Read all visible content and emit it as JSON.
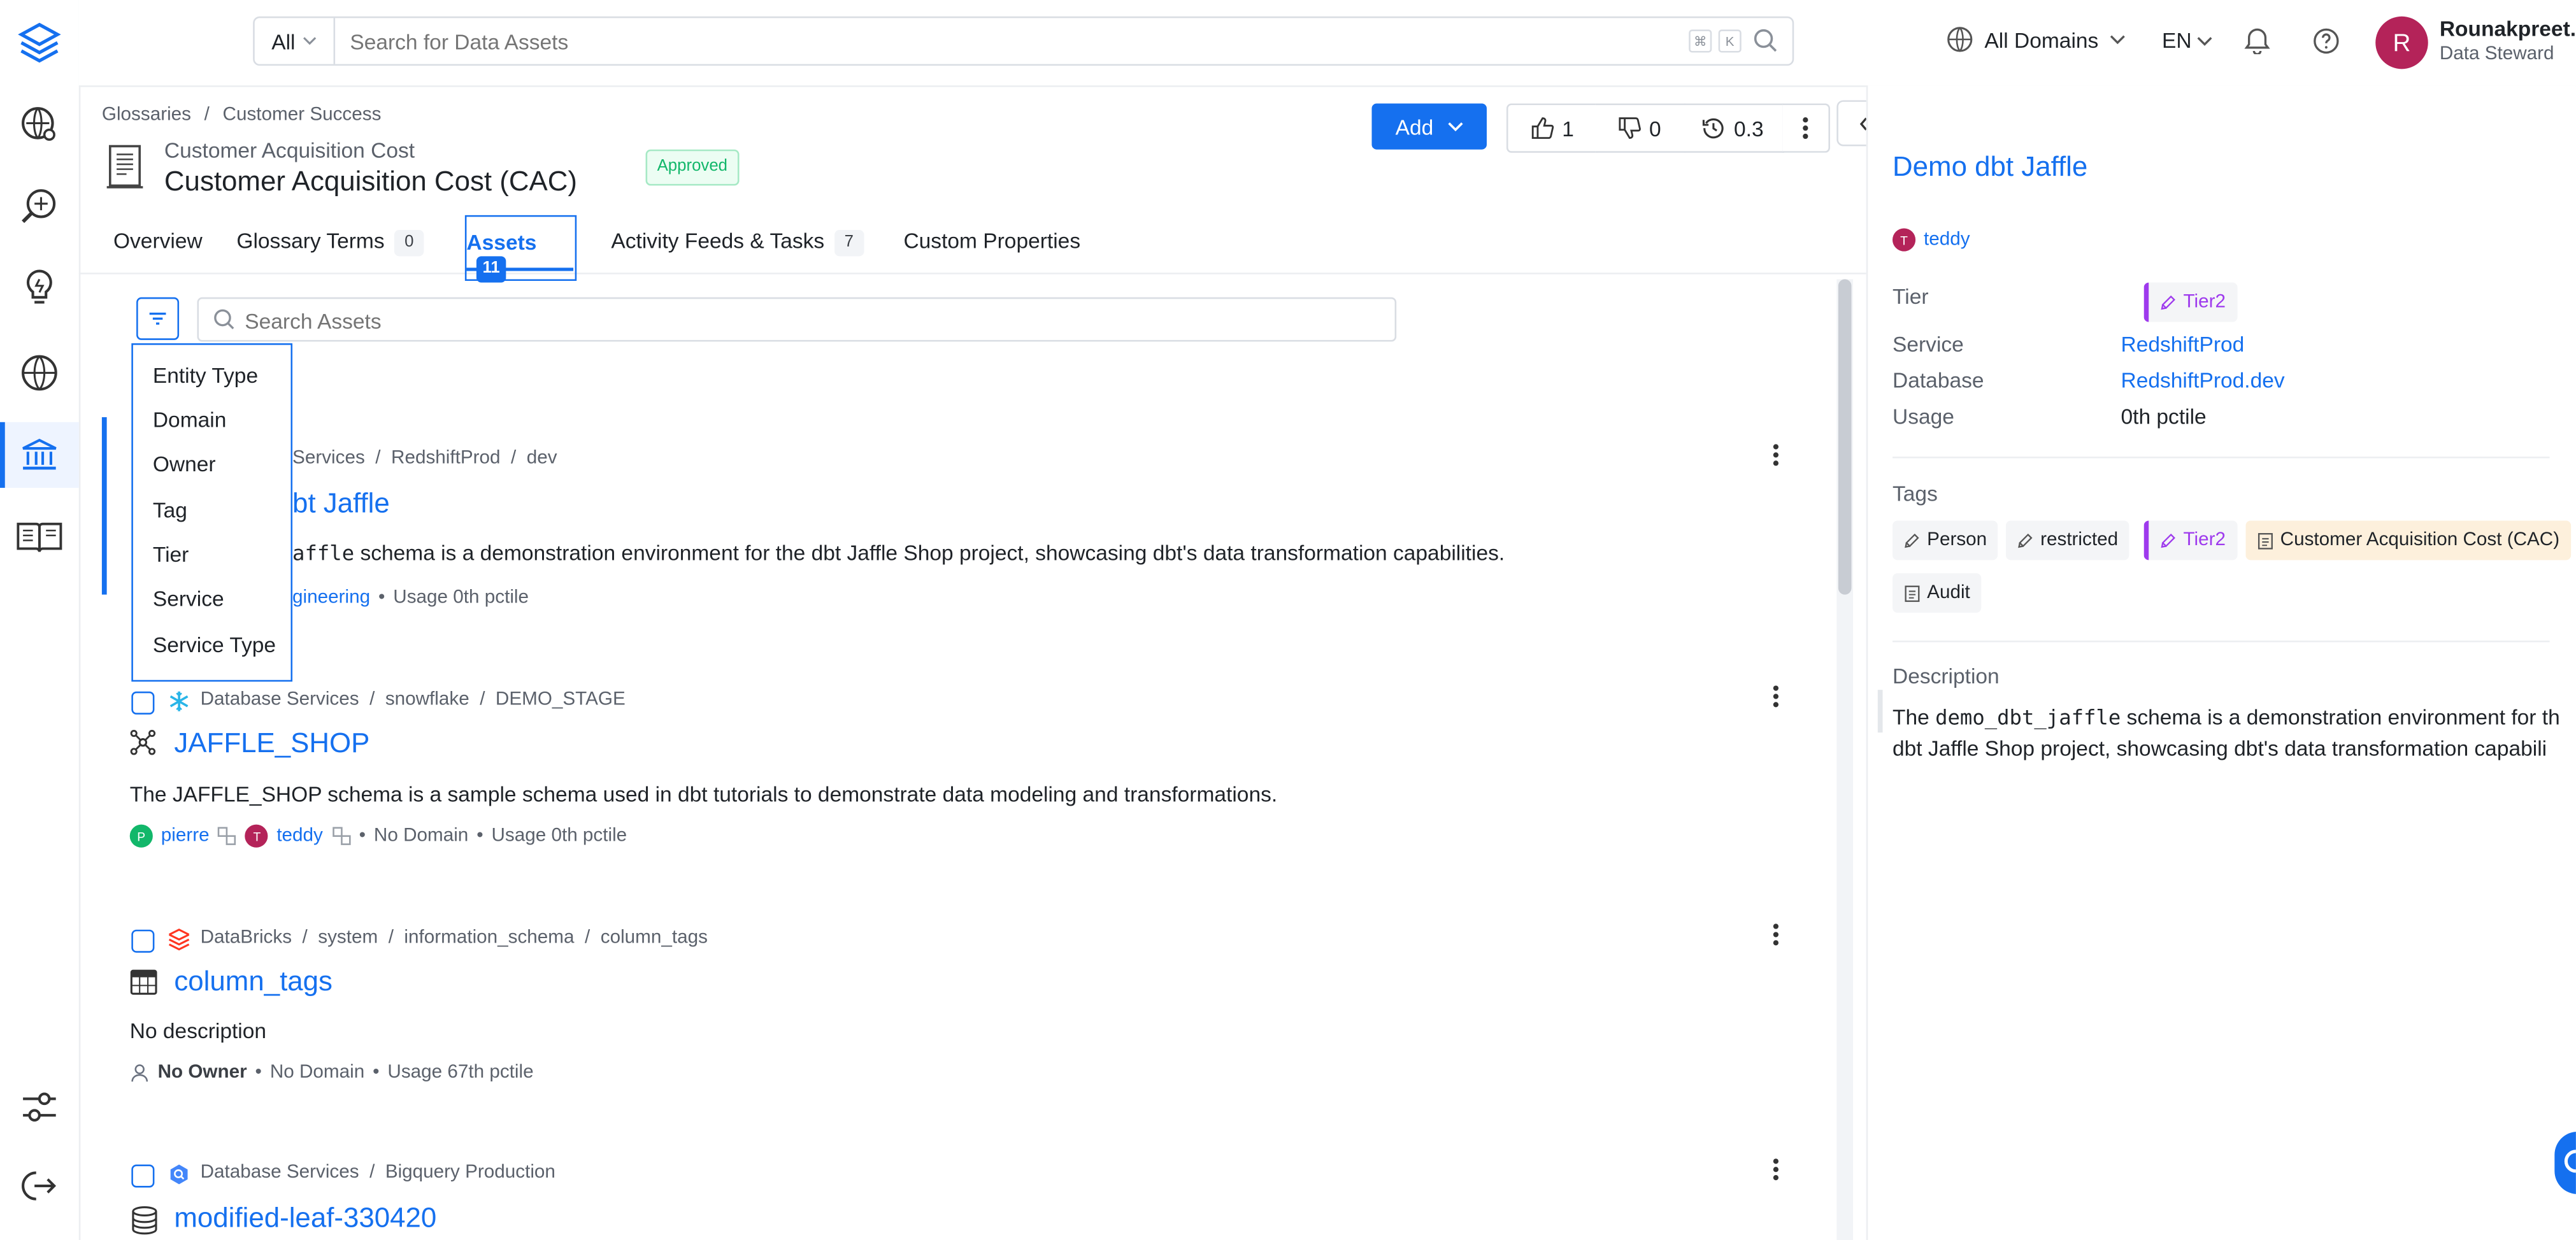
{
  "search": {
    "type_label": "All",
    "placeholder": "Search for Data Assets",
    "kbd1": "⌘",
    "kbd2": "K"
  },
  "header": {
    "domain_label": "All Domains",
    "lang": "EN",
    "user_name": "Rounakpreet.c",
    "user_role": "Data Steward",
    "avatar_letter": "R"
  },
  "breadcrumb": {
    "root": "Glossaries",
    "sep": "/",
    "current": "Customer Success"
  },
  "term": {
    "name": "Customer Acquisition Cost",
    "display_name": "Customer Acquisition Cost (CAC)",
    "status": "Approved"
  },
  "actions": {
    "add_label": "Add",
    "likes": "1",
    "dislikes": "0",
    "version": "0.3"
  },
  "tabs": {
    "overview": "Overview",
    "glossary_terms": "Glossary Terms",
    "glossary_terms_count": "0",
    "assets": "Assets",
    "assets_count": "11",
    "activity": "Activity Feeds & Tasks",
    "activity_count": "7",
    "custom_props": "Custom Properties"
  },
  "assets_search": {
    "placeholder": "Search Assets"
  },
  "filter_menu": [
    "Entity Type",
    "Domain",
    "Owner",
    "Tag",
    "Tier",
    "Service",
    "Service Type"
  ],
  "assets": [
    {
      "crumbs": [
        "Services",
        "RedshiftProd",
        "dev"
      ],
      "title_tail": "bt Jaffle",
      "desc_before": "",
      "desc_code": "affle",
      "desc_after": " schema is a demonstration environment for the dbt Jaffle Shop project, showcasing dbt's data transformation capabilities.",
      "owner_tail": "gineering",
      "usage": "Usage 0th pctile"
    },
    {
      "crumbs": [
        "Database Services",
        "snowflake",
        "DEMO_STAGE"
      ],
      "title": "JAFFLE_SHOP",
      "desc": "The JAFFLE_SHOP schema is a sample schema used in dbt tutorials to demonstrate data modeling and transformations.",
      "owner1": "pierre",
      "owner1_initial": "P",
      "owner2": "teddy",
      "owner2_initial": "T",
      "domain": "No Domain",
      "usage": "Usage 0th pctile"
    },
    {
      "crumbs": [
        "DataBricks",
        "system",
        "information_schema",
        "column_tags"
      ],
      "title": "column_tags",
      "desc": "No description",
      "owner": "No Owner",
      "domain": "No Domain",
      "usage": "Usage 67th pctile"
    },
    {
      "crumbs": [
        "Database Services",
        "Bigquery Production"
      ],
      "title": "modified-leaf-330420"
    }
  ],
  "panel": {
    "title": "Demo dbt Jaffle",
    "owner": "teddy",
    "owner_initial": "T",
    "tier_label": "Tier",
    "tier_value": "Tier2",
    "service_label": "Service",
    "service_value": "RedshiftProd",
    "database_label": "Database",
    "database_value": "RedshiftProd.dev",
    "usage_label": "Usage",
    "usage_value": "0th pctile",
    "tags_label": "Tags",
    "tags": [
      "Person",
      "restricted",
      "Tier2",
      "Customer Acquisition Cost (CAC)",
      "Audit"
    ],
    "description_label": "Description",
    "desc_line1_before": "The ",
    "desc_code": "demo_dbt_jaffle",
    "desc_line1_after": " schema is a demonstration environment for th",
    "desc_line2": "dbt Jaffle Shop project, showcasing dbt's data transformation capabili"
  },
  "colors": {
    "accent": "#1570ef",
    "tier": "#9e3aed",
    "approved": "#12b76a",
    "avatar": "#b42359",
    "glossary_tag_bg": "#fdf0dc"
  }
}
